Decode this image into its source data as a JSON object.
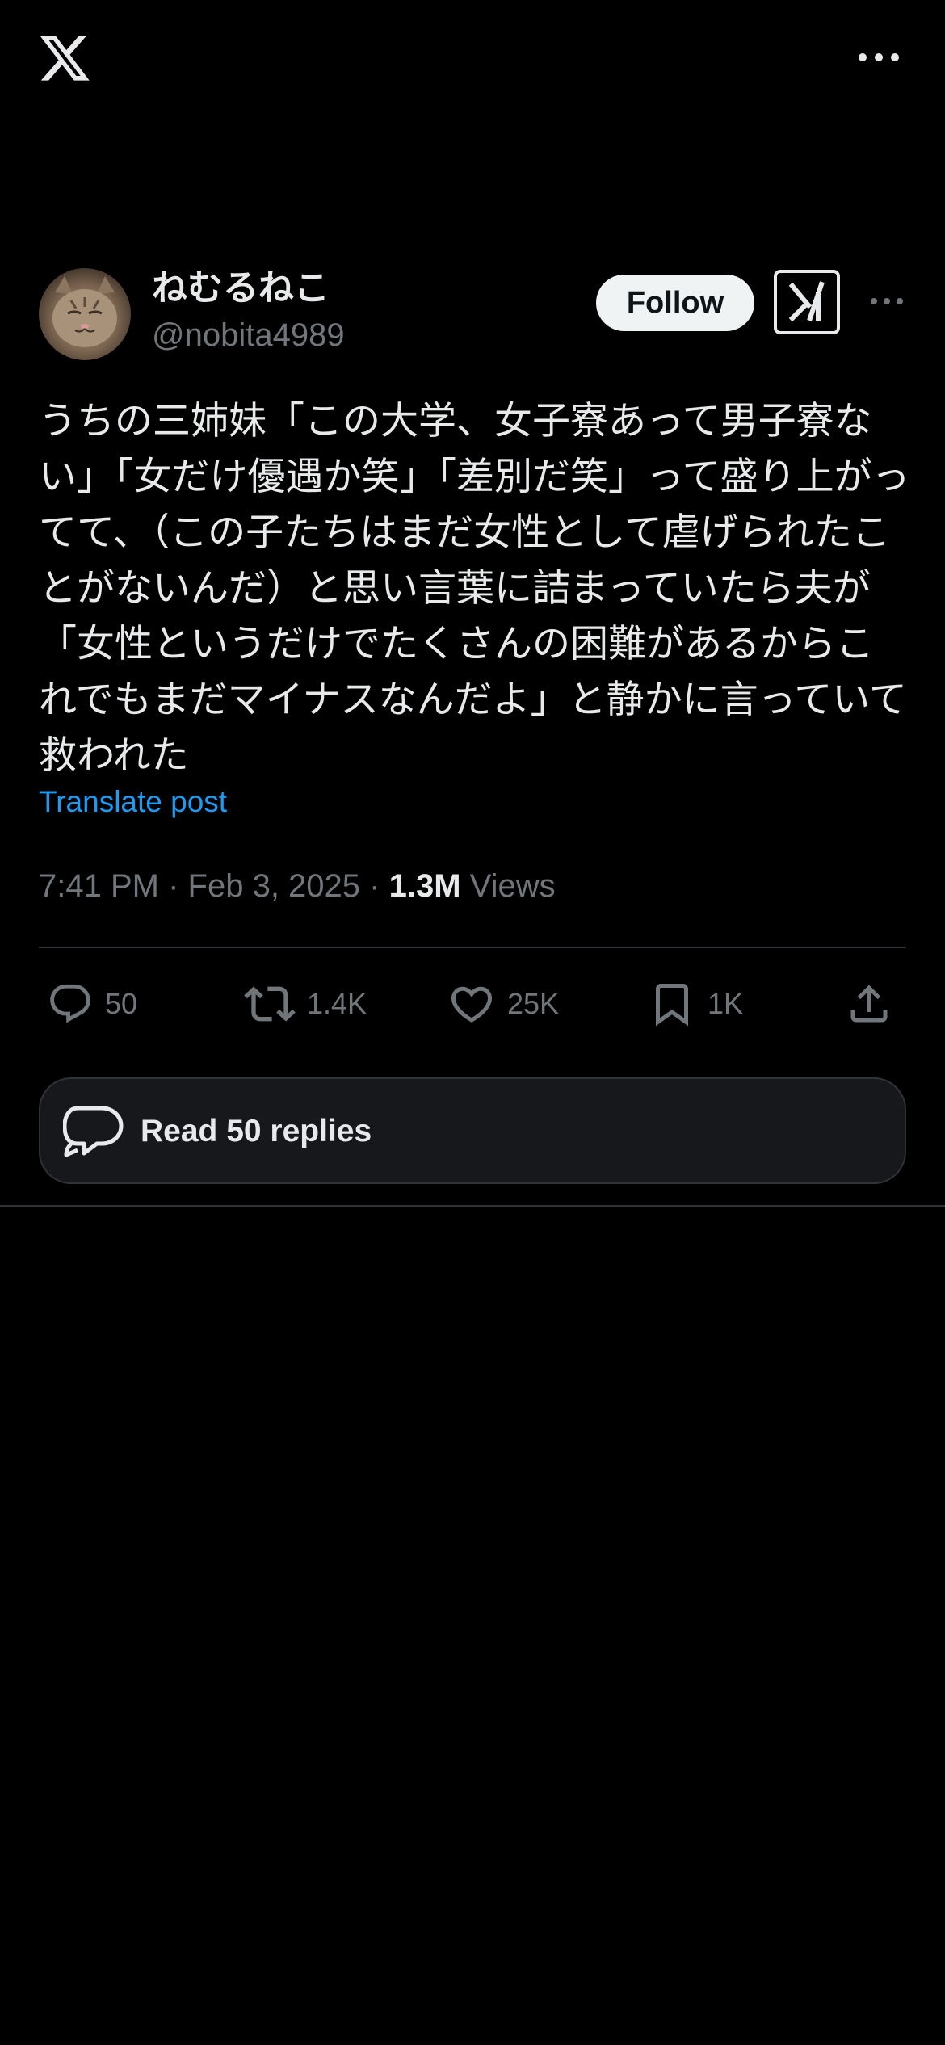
{
  "colors": {
    "background": "#000000",
    "text": "#e7e9ea",
    "secondary_text": "#71767b",
    "link": "#1d9bf0",
    "divider": "#2f3336",
    "card": "#16181c"
  },
  "topbar": {
    "logo_icon": "x-logo-icon",
    "more_icon": "more-horizontal-icon"
  },
  "author": {
    "display_name": "ねむるねこ",
    "handle": "@nobita4989",
    "follow_label": "Follow",
    "grok_icon": "grok-icon",
    "more_icon": "more-horizontal-icon"
  },
  "tweet": {
    "text": "うちの三姉妹「この大学、女子寮あって男子寮ない」「女だけ優遇か笑」「差別だ笑」って盛り上がってて、（この子たちはまだ女性として虐げられたことがないんだ）と思い言葉に詰まっていたら夫が「女性というだけでたくさんの困難があるからこれでもまだマイナスなんだよ」と静かに言っていて救われた",
    "translate_label": "Translate post",
    "time": "7:41 PM",
    "separator": "·",
    "date": "Feb 3, 2025",
    "views_count": "1.3M",
    "views_label": "Views"
  },
  "actions": {
    "replies": "50",
    "reposts": "1.4K",
    "likes": "25K",
    "bookmarks": "1K"
  },
  "read_replies": {
    "label": "Read 50 replies"
  }
}
